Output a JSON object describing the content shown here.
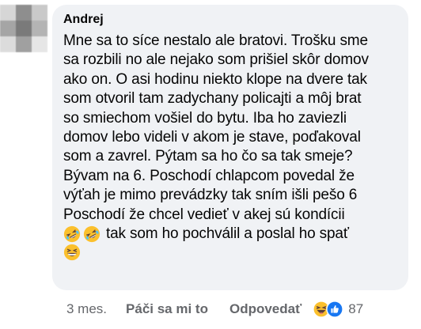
{
  "comment": {
    "author": "Andrej",
    "lines": [
      "Mne sa to síce nestalo ale bratovi. Trošku sme",
      "sa rozbili no ale nejako som prišiel skôr domov",
      "ako on. O asi hodinu niekto klope na dvere tak",
      "som otvoril tam zadychany policajti a môj brat",
      "so smiechom vošiel do bytu. Iba ho zaviezli",
      "domov lebo videli v akom je stave, poďakoval",
      "som a zavrel. Pýtam sa ho čo sa tak smeje?",
      "Bývam na 6. Poschodí chlapcom povedal že",
      "výťah je mimo prevádzky tak sním išli pešo 6",
      "Poschodí že chcel vedieť v akej sú kondícii"
    ],
    "emoji_line_text": "tak som ho pochválil a poslal ho spať",
    "emojis": [
      "rolling-on-floor-laughing",
      "rolling-on-floor-laughing",
      "grinning-squinting-face"
    ]
  },
  "actions": {
    "time": "3 mes.",
    "like_label": "Páči sa mi to",
    "reply_label": "Odpovedať",
    "reaction_icons": [
      "haha-reaction",
      "like-reaction"
    ],
    "reaction_count": "87"
  },
  "colors": {
    "bubble": "#f0f2f5",
    "text": "#050505",
    "secondary": "#65676b",
    "like_blue": "#1877f2",
    "emoji_yellow": "#fbc02d"
  }
}
